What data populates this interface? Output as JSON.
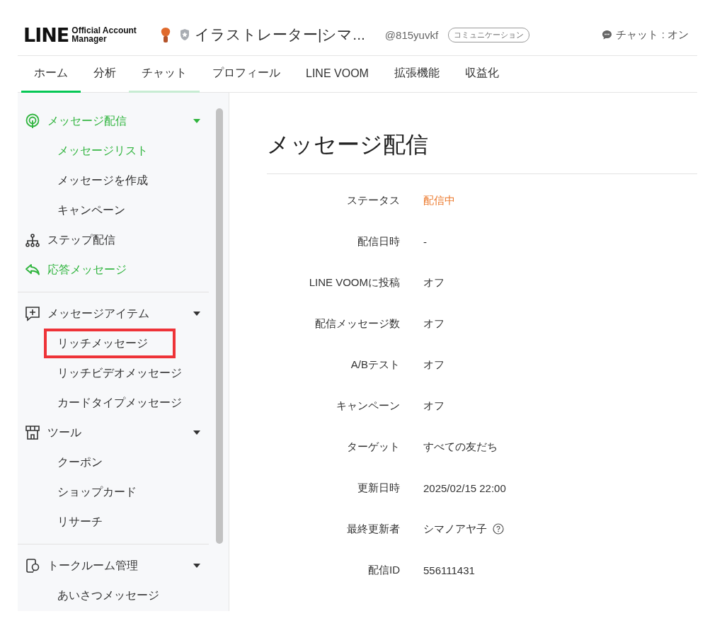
{
  "header": {
    "logo": {
      "wordmark": "LINE",
      "subtitle_1": "Official Account",
      "subtitle_2": "Manager"
    },
    "account_name": "イラストレーター|シマ...",
    "account_id": "@815yuvkf",
    "plan_badge": "コミュニケーション",
    "chat_status": "チャット : オン"
  },
  "tabs": [
    {
      "label": "ホーム",
      "selected": true,
      "hovered": false
    },
    {
      "label": "分析",
      "selected": false,
      "hovered": false
    },
    {
      "label": "チャット",
      "selected": false,
      "hovered": true
    },
    {
      "label": "プロフィール",
      "selected": false,
      "hovered": false
    },
    {
      "label": "LINE VOOM",
      "selected": false,
      "hovered": false
    },
    {
      "label": "拡張機能",
      "selected": false,
      "hovered": false
    },
    {
      "label": "収益化",
      "selected": false,
      "hovered": false
    }
  ],
  "sidebar": {
    "sections": [
      {
        "groups": [
          {
            "label": "メッセージ配信",
            "active": true,
            "expanded": true,
            "children": [
              {
                "label": "メッセージリスト",
                "selected": true,
                "highlighted": false
              },
              {
                "label": "メッセージを作成",
                "selected": false,
                "highlighted": false
              },
              {
                "label": "キャンペーン",
                "selected": false,
                "highlighted": false
              }
            ]
          },
          {
            "label": "ステップ配信",
            "active": false
          },
          {
            "label": "応答メッセージ",
            "active": true
          }
        ]
      },
      {
        "groups": [
          {
            "label": "メッセージアイテム",
            "active": false,
            "expanded": true,
            "children": [
              {
                "label": "リッチメッセージ",
                "selected": false,
                "highlighted": true
              },
              {
                "label": "リッチビデオメッセージ",
                "selected": false,
                "highlighted": false
              },
              {
                "label": "カードタイプメッセージ",
                "selected": false,
                "highlighted": false
              }
            ]
          },
          {
            "label": "ツール",
            "active": false,
            "expanded": true,
            "children": [
              {
                "label": "クーポン",
                "selected": false,
                "highlighted": false
              },
              {
                "label": "ショップカード",
                "selected": false,
                "highlighted": false
              },
              {
                "label": "リサーチ",
                "selected": false,
                "highlighted": false
              }
            ]
          }
        ]
      },
      {
        "groups": [
          {
            "label": "トークルーム管理",
            "active": false,
            "expanded": true,
            "children": [
              {
                "label": "あいさつメッセージ",
                "selected": false,
                "highlighted": false
              }
            ]
          }
        ]
      }
    ]
  },
  "main": {
    "title": "メッセージ配信",
    "details": [
      {
        "label": "ステータス",
        "value": "配信中",
        "kind": "status"
      },
      {
        "label": "配信日時",
        "value": "-",
        "kind": "text"
      },
      {
        "label": "LINE VOOMに投稿",
        "value": "オフ",
        "kind": "text"
      },
      {
        "label": "配信メッセージ数",
        "value": "オフ",
        "kind": "text"
      },
      {
        "label": "A/Bテスト",
        "value": "オフ",
        "kind": "text"
      },
      {
        "label": "キャンペーン",
        "value": "オフ",
        "kind": "text"
      },
      {
        "label": "ターゲット",
        "value": "すべての友だち",
        "kind": "text"
      },
      {
        "label": "更新日時",
        "value": "2025/02/15 22:00",
        "kind": "text"
      },
      {
        "label": "最終更新者",
        "value": "シマノアヤ子",
        "kind": "user"
      },
      {
        "label": "配信ID",
        "value": "556111431",
        "kind": "text"
      }
    ]
  }
}
